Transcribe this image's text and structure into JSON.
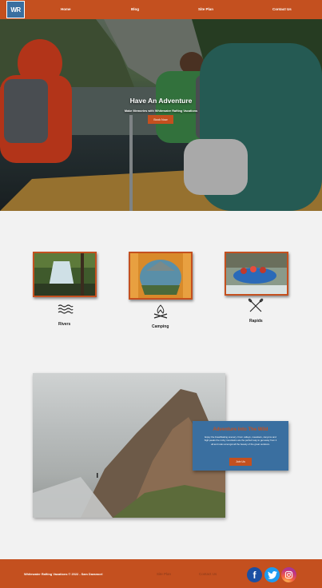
{
  "header": {
    "logo_text": "WR",
    "nav": {
      "home": "Home",
      "blog": "Blog",
      "site_plan": "Site Plan",
      "contact": "Contact Us"
    }
  },
  "hero": {
    "title": "Have An Adventure",
    "subtitle": "Make Memories with Whitewater Rafting Vacations",
    "button": "Book Now"
  },
  "features": [
    {
      "label": "Rivers",
      "icon": "waves-icon"
    },
    {
      "label": "Camping",
      "icon": "campfire-icon"
    },
    {
      "label": "Rapids",
      "icon": "crossed-paddles-icon"
    }
  ],
  "promo": {
    "title": "Adventure Into The Wild",
    "text": "Enjoy the breathtaking scenery. From valleys, meadows, canyons and high peaks the rocky mountains are the perfect way to get away from it all and relax amongst all the beauty of the great outdoors.",
    "button": "Join Us"
  },
  "footer": {
    "copyright": "Whitewater Rafting Vacations © 2022 - Sam Daramcel",
    "site_plan": "Site Plan",
    "contact": "Contact Us",
    "social": [
      "facebook-icon",
      "twitter-icon",
      "instagram-icon"
    ]
  },
  "colors": {
    "brand_orange": "#c4501f",
    "brand_blue": "#3a6fa0",
    "background": "#f2f2f2"
  }
}
